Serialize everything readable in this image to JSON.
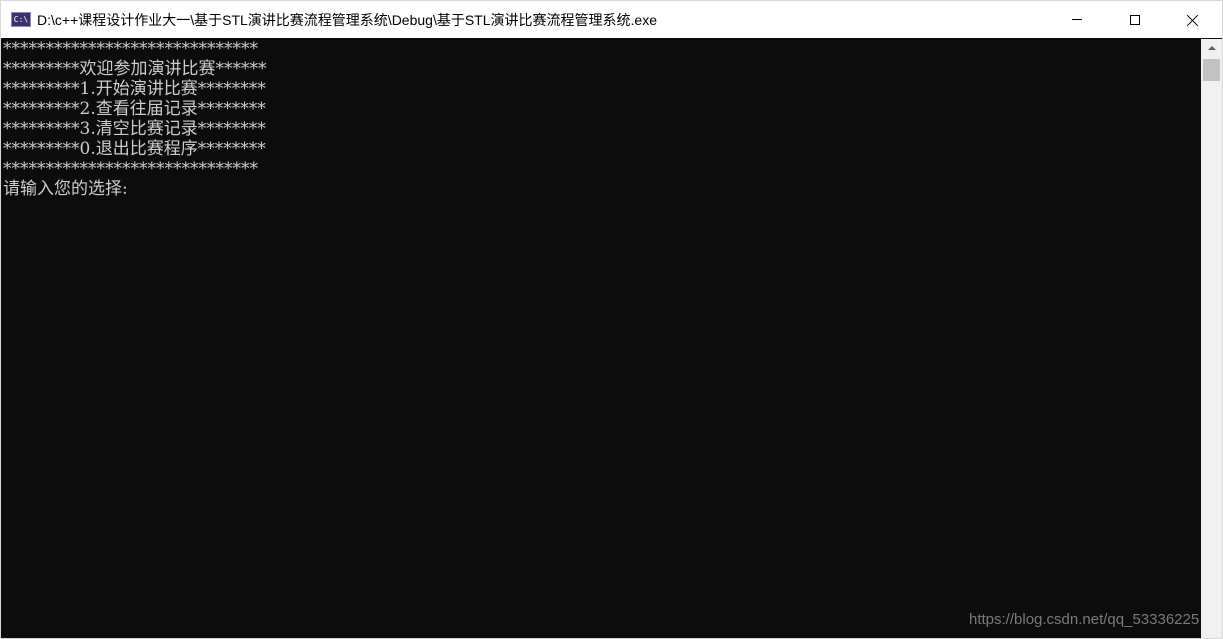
{
  "window": {
    "title": "D:\\c++课程设计作业大一\\基于STL演讲比赛流程管理系统\\Debug\\基于STL演讲比赛流程管理系统.exe",
    "icon_label": "C:\\",
    "controls": {
      "minimize": "minimize-icon",
      "maximize": "maximize-icon",
      "close": "close-icon"
    }
  },
  "console": {
    "lines": [
      "******************************",
      "*********欢迎参加演讲比赛******",
      "*********1.开始演讲比赛********",
      "*********2.查看往届记录********",
      "*********3.清空比赛记录********",
      "*********0.退出比赛程序********",
      "******************************",
      "请输入您的选择:"
    ],
    "background": "#0c0c0c",
    "text_color": "#cccccc"
  },
  "watermark": "https://blog.csdn.net/qq_53336225"
}
